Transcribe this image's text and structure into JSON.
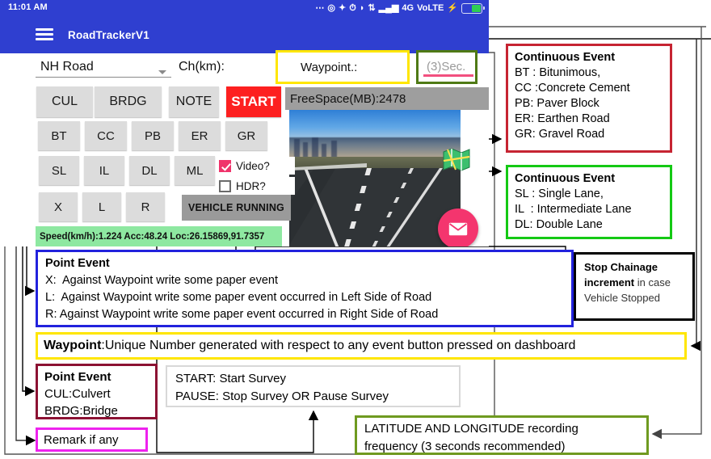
{
  "app": {
    "status_bar": {
      "time": "11:01 AM",
      "icons": [
        "more-icon",
        "headset-icon",
        "bluetooth-icon",
        "alarm-icon",
        "wifi-icon",
        "data-transfer-icon",
        "signal-bars-icon"
      ],
      "network": "4G",
      "volte": "VoLTE",
      "charging": "charging-bolt-icon"
    },
    "title": "RoadTrackerV1",
    "menu_icon": "hamburger-menu-icon",
    "road_type": "NH Road",
    "chainage_label": "Ch(km):",
    "free_space": "FreeSpace(MB):2478",
    "vehicle_status": "VEHICLE RUNNING",
    "speed_line": "Speed(km/h):1.224 Acc:48.24 Loc:26.15869,91.7357",
    "checkboxes": [
      {
        "label": "Video?",
        "checked": true
      },
      {
        "label": "HDR?",
        "checked": false
      }
    ],
    "rows": {
      "row1": [
        "CUL",
        "BRDG",
        "NOTE",
        "START"
      ],
      "row2": [
        "BT",
        "CC",
        "PB",
        "ER",
        "GR"
      ],
      "row3": [
        "SL",
        "IL",
        "DL",
        "ML"
      ],
      "row4": [
        "X",
        "L",
        "R"
      ]
    },
    "fab_icon": "envelope-icon",
    "map_icon": "map-icon"
  },
  "annotations": {
    "waypoint_field": {
      "label": "Waypoint.:",
      "border_color": "#ffe600"
    },
    "sec_field": {
      "value": "(3)Sec.",
      "border_color": "#4f7a15",
      "underline_color": "#f2507f"
    },
    "continuous_event_surface": {
      "title": "Continuous Event",
      "lines": [
        "BT : Bitunimous,",
        "CC :Concrete Cement",
        "PB: Paver Block",
        "ER: Earthen Road",
        "GR: Gravel Road"
      ],
      "border_color": "#c62432"
    },
    "continuous_event_lane": {
      "title": "Continuous Event",
      "lines": [
        "SL : Single Lane,",
        "IL  : Intermediate Lane",
        "DL: Double Lane"
      ],
      "border_color": "#14c914"
    },
    "point_event_xlr": {
      "title": "Point Event",
      "lines": [
        "X:  Against Waypoint write some paper event",
        "L:  Against Waypoint write some paper event occurred in Left Side of Road",
        "R: Against Waypoint write some paper event occurred in Right Side of Road"
      ],
      "border_color": "#2222dd"
    },
    "stop_chainage": {
      "bold": "Stop Chainage increment",
      "rest": " in case Vehicle Stopped",
      "line1_bold": "Stop Chainage",
      "line2_bold": "increment",
      "line2_rest": " in case",
      "line3": "Vehicle Stopped",
      "border_color": "#000000"
    },
    "waypoint_desc": {
      "bold": "Waypoint",
      "rest": ":Unique Number generated with respect to any event button pressed on dashboard",
      "border_color": "#ffe600"
    },
    "point_event_cul": {
      "title": "Point Event",
      "lines": [
        "CUL:Culvert",
        "BRDG:Bridge"
      ],
      "border_color": "#8c1233"
    },
    "remark": {
      "text": "Remark if any",
      "border_color": "#ee22ee"
    },
    "start_pause": {
      "lines": [
        "START: Start Survey",
        "PAUSE: Stop Survey OR Pause Survey"
      ],
      "border_color": "#d8d8d8"
    },
    "latitude_longitude": {
      "lines": [
        "LATITUDE AND LONGITUDE recording",
        "frequency (3 seconds recommended)"
      ],
      "border_color": "#6f9a20"
    }
  }
}
